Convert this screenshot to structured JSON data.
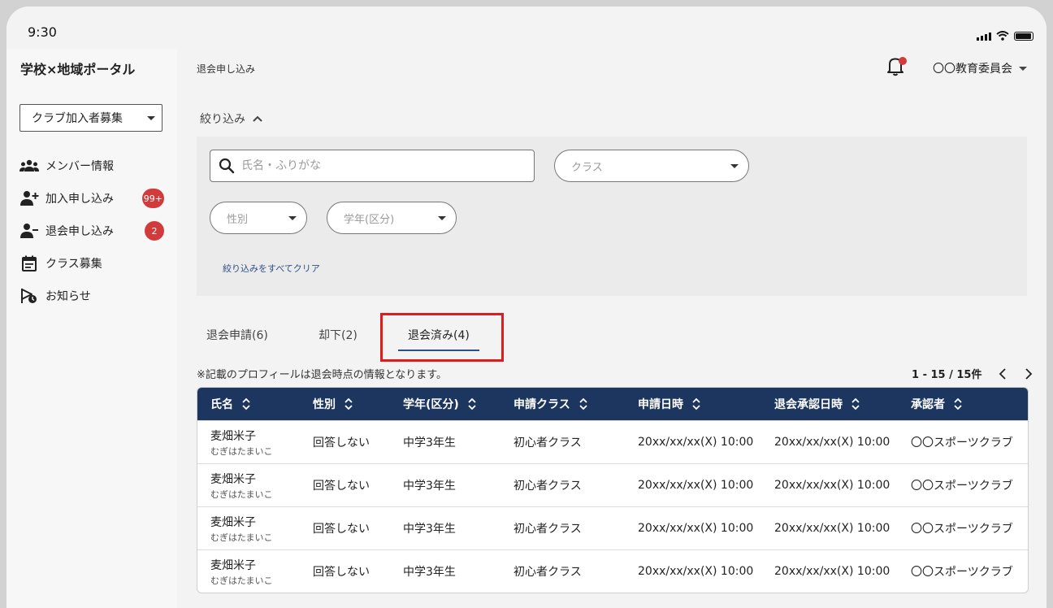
{
  "status_bar": {
    "time": "9:30"
  },
  "app": {
    "title": "学校×地域ポータル"
  },
  "sidebar": {
    "club_select": {
      "value": "クラブ加入者募集"
    },
    "items": [
      {
        "label": "メンバー情報",
        "icon": "members-icon",
        "badge": ""
      },
      {
        "label": "加入申し込み",
        "icon": "person-add-icon",
        "badge": "99+"
      },
      {
        "label": "退会申し込み",
        "icon": "person-remove-icon",
        "badge": "2"
      },
      {
        "label": "クラス募集",
        "icon": "calendar-icon",
        "badge": ""
      },
      {
        "label": "お知らせ",
        "icon": "announcement-icon",
        "badge": ""
      }
    ]
  },
  "header": {
    "breadcrumb": "退会申し込み",
    "account": "〇〇教育委員会"
  },
  "filter": {
    "toggle_label": "絞り込み",
    "search_placeholder": "氏名・ふりがな",
    "class_placeholder": "クラス",
    "gender_placeholder": "性別",
    "grade_placeholder": "学年(区分)",
    "clear_label": "絞り込みをすべてクリア"
  },
  "tabs": [
    {
      "label": "退会申請(6)",
      "active": false
    },
    {
      "label": "却下(2)",
      "active": false
    },
    {
      "label": "退会済み(4)",
      "active": true
    }
  ],
  "note": "※記載のプロフィールは退会時点の情報となります。",
  "pagination": {
    "text": "1 - 15 / 15件"
  },
  "table": {
    "columns": [
      "氏名",
      "性別",
      "学年(区分)",
      "申請クラス",
      "申請日時",
      "退会承認日時",
      "承認者"
    ],
    "rows": [
      {
        "name": "麦畑米子",
        "kana": "むぎはたまいこ",
        "gender": "回答しない",
        "grade": "中学3年生",
        "class": "初心者クラス",
        "applied": "20xx/xx/xx(X) 10:00",
        "approved": "20xx/xx/xx(X) 10:00",
        "approver": "〇〇スポーツクラブ"
      },
      {
        "name": "麦畑米子",
        "kana": "むぎはたまいこ",
        "gender": "回答しない",
        "grade": "中学3年生",
        "class": "初心者クラス",
        "applied": "20xx/xx/xx(X) 10:00",
        "approved": "20xx/xx/xx(X) 10:00",
        "approver": "〇〇スポーツクラブ"
      },
      {
        "name": "麦畑米子",
        "kana": "むぎはたまいこ",
        "gender": "回答しない",
        "grade": "中学3年生",
        "class": "初心者クラス",
        "applied": "20xx/xx/xx(X) 10:00",
        "approved": "20xx/xx/xx(X) 10:00",
        "approver": "〇〇スポーツクラブ"
      },
      {
        "name": "麦畑米子",
        "kana": "むぎはたまいこ",
        "gender": "回答しない",
        "grade": "中学3年生",
        "class": "初心者クラス",
        "applied": "20xx/xx/xx(X) 10:00",
        "approved": "20xx/xx/xx(X) 10:00",
        "approver": "〇〇スポーツクラブ"
      }
    ]
  },
  "colors": {
    "header_navy": "#1d3660",
    "badge_red": "#d23b3b",
    "highlight_red": "#e01b1b",
    "link_blue": "#2b4f86"
  }
}
